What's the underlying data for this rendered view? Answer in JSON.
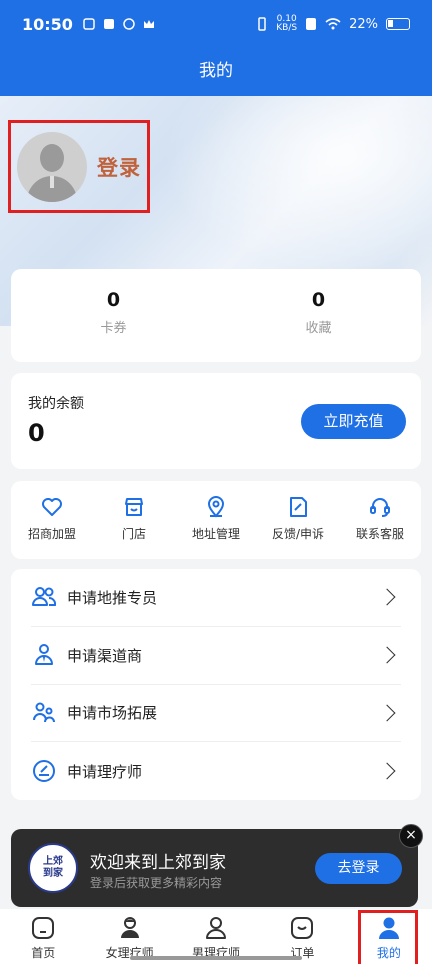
{
  "status_bar": {
    "time": "10:50",
    "speed_value": "0.10",
    "speed_unit": "KB/S",
    "battery": "22%"
  },
  "header": {
    "title": "我的"
  },
  "profile": {
    "login_label": "登录"
  },
  "stats": [
    {
      "value": "0",
      "label": "卡券"
    },
    {
      "value": "0",
      "label": "收藏"
    }
  ],
  "balance": {
    "label": "我的余额",
    "value": "0",
    "recharge_label": "立即充值"
  },
  "quick_actions": [
    {
      "label": "招商加盟",
      "icon": "heart-icon"
    },
    {
      "label": "门店",
      "icon": "store-icon"
    },
    {
      "label": "地址管理",
      "icon": "location-pin-icon"
    },
    {
      "label": "反馈/申诉",
      "icon": "edit-note-icon"
    },
    {
      "label": "联系客服",
      "icon": "headset-icon"
    }
  ],
  "menu": [
    {
      "label": "申请地推专员",
      "icon": "users-icon"
    },
    {
      "label": "申请渠道商",
      "icon": "agent-icon"
    },
    {
      "label": "申请市场拓展",
      "icon": "team-icon"
    },
    {
      "label": "申请理疗师",
      "icon": "therapist-icon"
    }
  ],
  "banner": {
    "logo_text_1": "上郊",
    "logo_text_2": "到家",
    "title": "欢迎来到上郊到家",
    "subtitle": "登录后获取更多精彩内容",
    "button_label": "去登录",
    "close_glyph": "×"
  },
  "tabbar": [
    {
      "label": "首页",
      "icon": "home-icon",
      "active": false
    },
    {
      "label": "女理疗师",
      "icon": "female-therapist-icon",
      "active": false
    },
    {
      "label": "男理疗师",
      "icon": "male-therapist-icon",
      "active": false
    },
    {
      "label": "订单",
      "icon": "order-icon",
      "active": false
    },
    {
      "label": "我的",
      "icon": "profile-icon",
      "active": true
    }
  ],
  "colors": {
    "primary": "#1f6fe5",
    "login_text": "#c0623c",
    "highlight": "#e02020"
  }
}
